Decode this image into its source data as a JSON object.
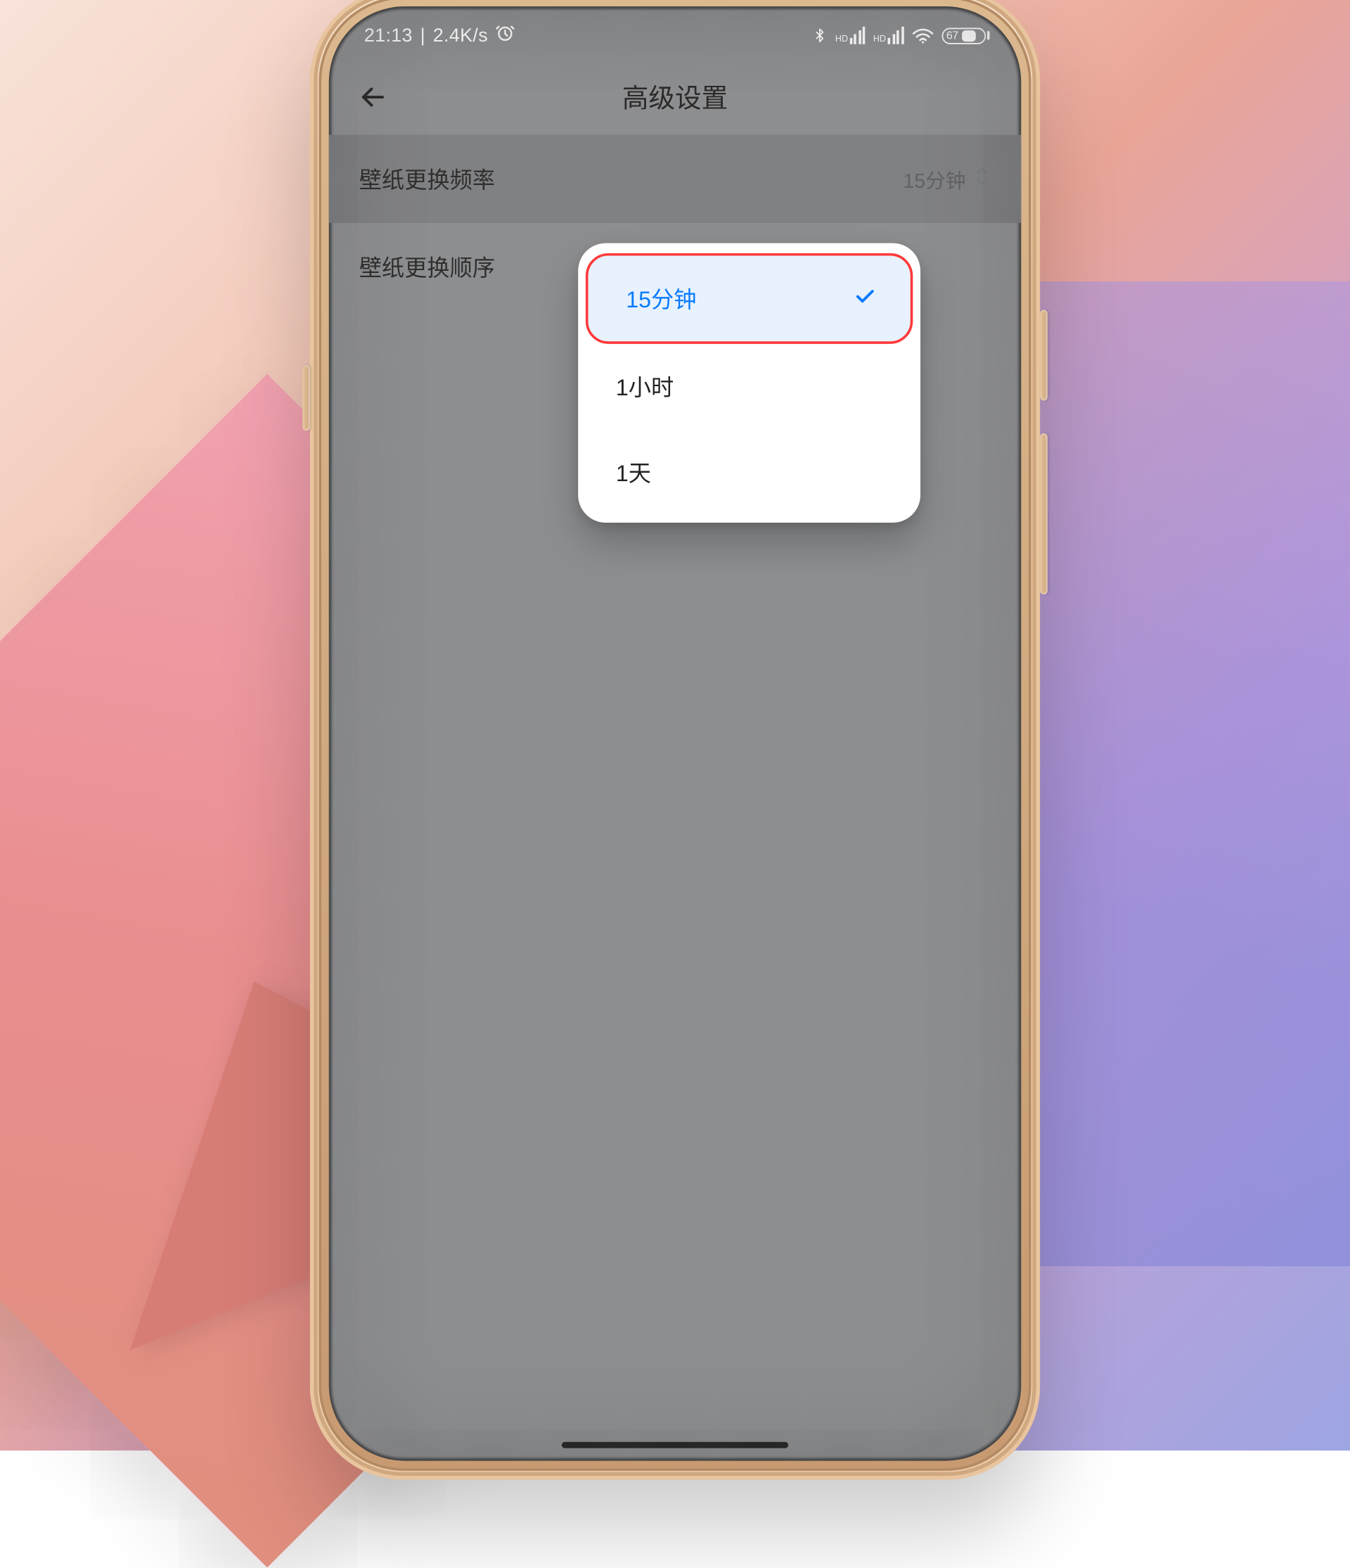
{
  "status": {
    "time": "21:13",
    "net_speed": "2.4K/s",
    "battery_pct": "67"
  },
  "appbar": {
    "title": "高级设置"
  },
  "rows": {
    "freq": {
      "label": "壁纸更换频率",
      "value": "15分钟"
    },
    "order": {
      "label": "壁纸更换顺序"
    }
  },
  "popup": {
    "options": [
      {
        "label": "15分钟",
        "selected": true
      },
      {
        "label": "1小时",
        "selected": false
      },
      {
        "label": "1天",
        "selected": false
      }
    ]
  }
}
